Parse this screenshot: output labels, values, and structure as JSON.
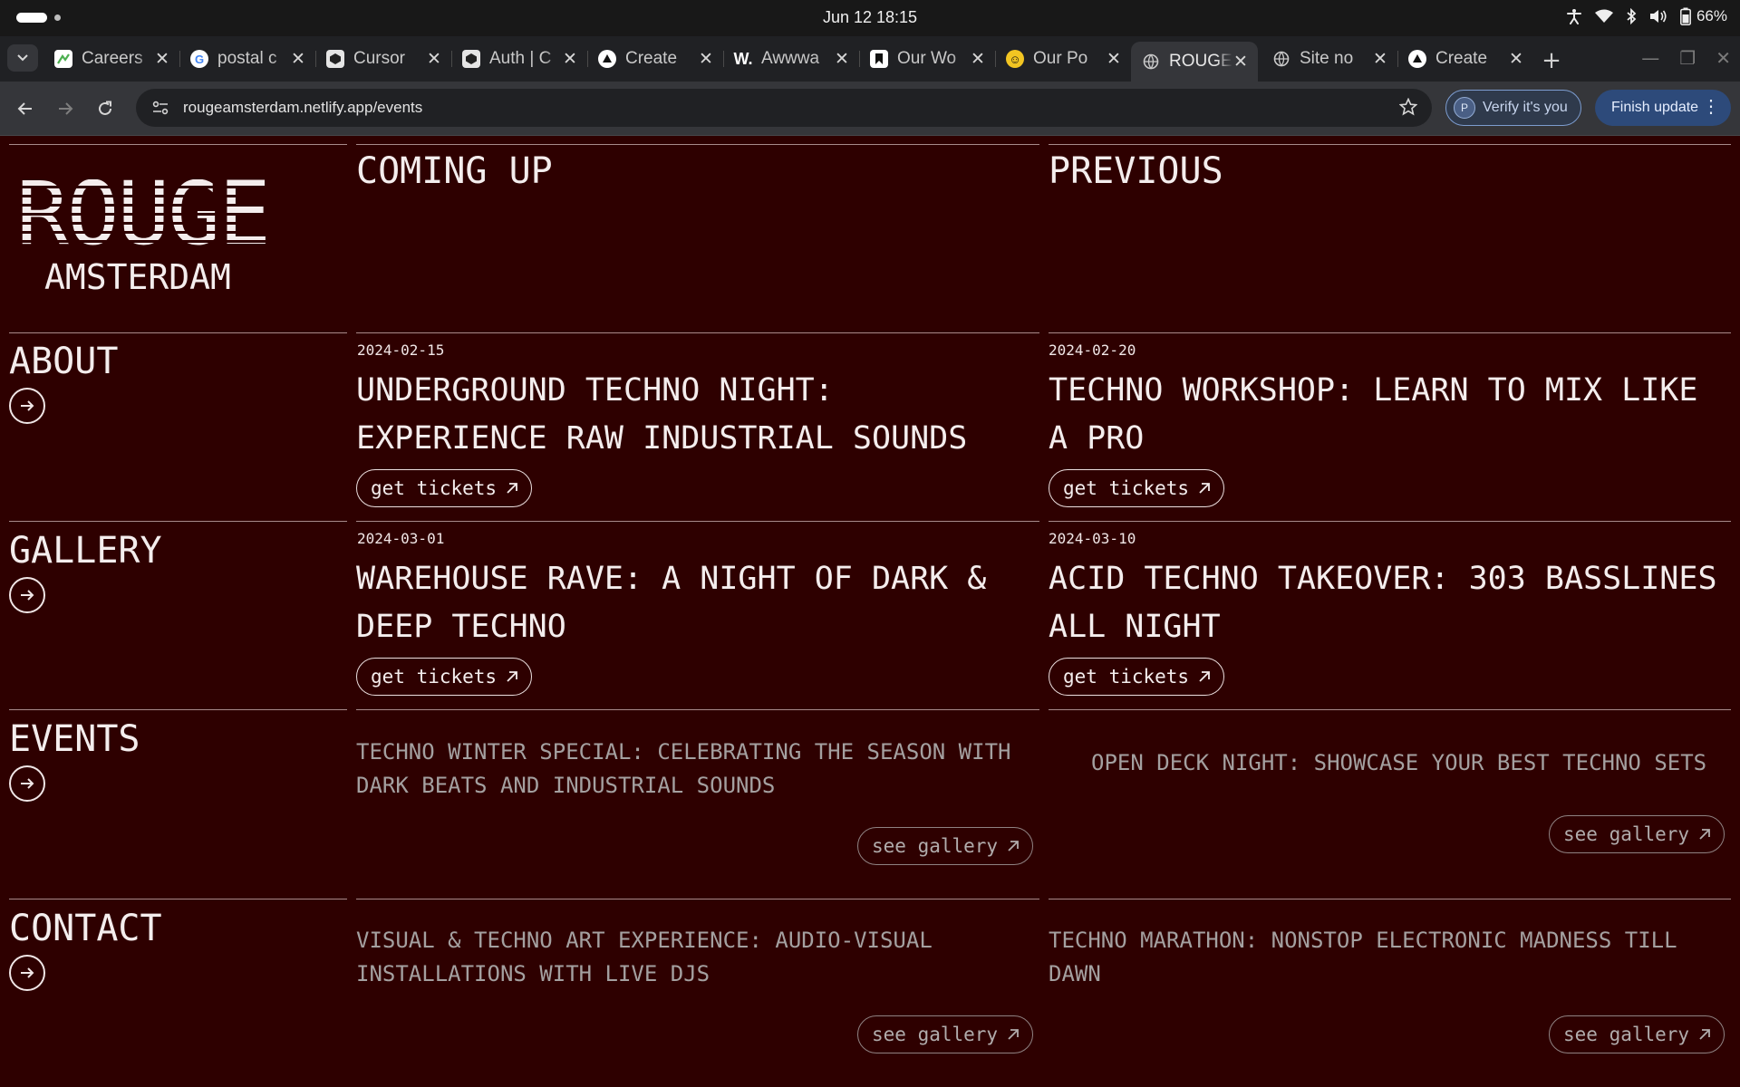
{
  "os": {
    "clock": "Jun 12  18:15",
    "battery": "66%"
  },
  "browser": {
    "tabs": [
      {
        "title": "Careers",
        "favicon": "careers-favicon"
      },
      {
        "title": "postal c",
        "favicon": "google-favicon"
      },
      {
        "title": "Cursor",
        "favicon": "cursor-favicon"
      },
      {
        "title": "Auth | C",
        "favicon": "cursor-favicon"
      },
      {
        "title": "Create",
        "favicon": "vercel-favicon"
      },
      {
        "title": "Awwwa",
        "favicon": "awwwards-favicon"
      },
      {
        "title": "Our Wo",
        "favicon": "bookmark-favicon"
      },
      {
        "title": "Our Po",
        "favicon": "smiley-favicon"
      },
      {
        "title": "ROUGE",
        "favicon": "globe-favicon",
        "active": true
      },
      {
        "title": "Site no",
        "favicon": "globe-favicon"
      },
      {
        "title": "Create",
        "favicon": "vercel-favicon"
      }
    ],
    "url": "rougeamsterdam.netlify.app/events",
    "verify_label": "Verify it's you",
    "verify_avatar": "P",
    "finish_update_label": "Finish update"
  },
  "site": {
    "logo": "ROUGE",
    "logo_sub": "AMSTERDAM",
    "columns": {
      "upcoming": "COMING UP",
      "previous": "PREVIOUS"
    },
    "nav": [
      {
        "label": "ABOUT"
      },
      {
        "label": "GALLERY"
      },
      {
        "label": "EVENTS"
      },
      {
        "label": "CONTACT"
      }
    ],
    "upcoming_events": [
      {
        "date": "2024-02-15",
        "title": "UNDERGROUND TECHNO NIGHT: EXPERIENCE RAW INDUSTRIAL SOUNDS",
        "cta": "get tickets"
      },
      {
        "date": "2024-02-20",
        "title": "TECHNO WORKSHOP: LEARN TO MIX LIKE A PRO",
        "cta": "get tickets"
      },
      {
        "date": "2024-03-01",
        "title": "WAREHOUSE RAVE: A NIGHT OF DARK & DEEP TECHNO",
        "cta": "get tickets"
      },
      {
        "date": "2024-03-10",
        "title": "ACID TECHNO TAKEOVER: 303 BASSLINES ALL NIGHT",
        "cta": "get tickets"
      }
    ],
    "previous_events": [
      {
        "title": "TECHNO WINTER SPECIAL: CELEBRATING THE SEASON WITH DARK BEATS AND INDUSTRIAL SOUNDS",
        "cta": "see gallery"
      },
      {
        "title": "OPEN DECK NIGHT: SHOWCASE YOUR BEST TECHNO SETS",
        "cta": "see gallery"
      },
      {
        "title": "VISUAL & TECHNO ART EXPERIENCE: AUDIO-VISUAL INSTALLATIONS WITH LIVE DJS",
        "cta": "see gallery"
      },
      {
        "title": "TECHNO MARATHON: NONSTOP ELECTRONIC MADNESS TILL DAWN",
        "cta": "see gallery"
      }
    ]
  },
  "colors": {
    "page_bg": "#2e0000",
    "text": "#f4eded",
    "muted_text": "#a4a0a0",
    "rule": "#a88a8a",
    "browser_chrome": "#35363a",
    "accent_button": "#2d4a7a"
  }
}
